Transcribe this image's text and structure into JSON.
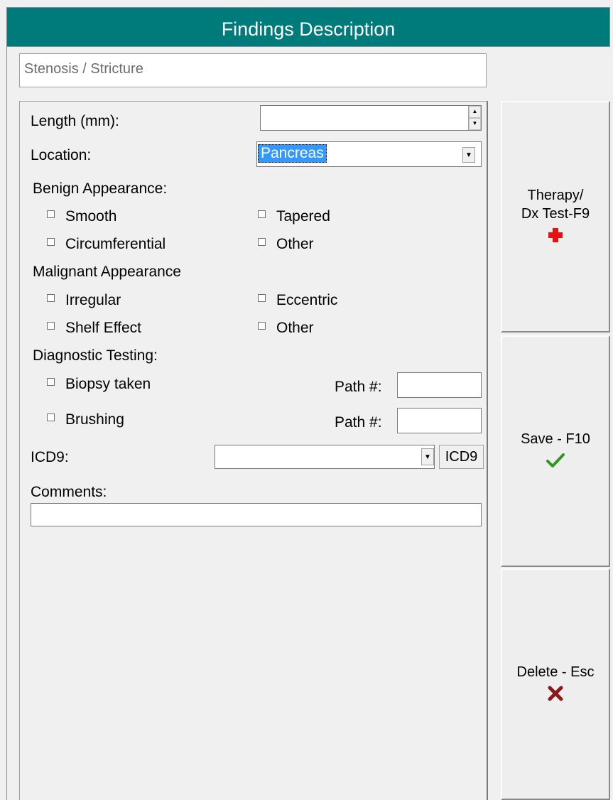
{
  "window": {
    "title": "Findings Description"
  },
  "finding": {
    "name": "Stenosis / Stricture"
  },
  "form": {
    "length_label": "Length (mm):",
    "length_value": "",
    "location_label": "Location:",
    "location_value": "Pancreas",
    "benign_heading": "Benign Appearance:",
    "benign_options": [
      "Smooth",
      "Tapered",
      "Circumferential",
      "Other"
    ],
    "malignant_heading": "Malignant Appearance",
    "malignant_options": [
      "Irregular",
      "Eccentric",
      "Shelf Effect",
      "Other"
    ],
    "diagnostic_heading": "Diagnostic Testing:",
    "biopsy_label": "Biopsy taken",
    "brushing_label": "Brushing",
    "path_label": "Path #:",
    "biopsy_path_value": "",
    "brushing_path_value": "",
    "icd9_label": "ICD9:",
    "icd9_value": "",
    "icd9_button": "ICD9",
    "comments_label": "Comments:",
    "comments_value": ""
  },
  "side_buttons": {
    "therapy_line1": "Therapy/",
    "therapy_line2": "Dx Test-F9",
    "therapy_icon": "red-cross-icon",
    "save_label": "Save - F10",
    "save_icon": "green-check-icon",
    "delete_label": "Delete - Esc",
    "delete_icon": "red-x-icon"
  },
  "colors": {
    "titlebar": "#007b7b",
    "selection": "#3399ff",
    "plus_red": "#e81010",
    "check_green": "#2d9a1e",
    "x_darkred": "#8b1a1a"
  }
}
